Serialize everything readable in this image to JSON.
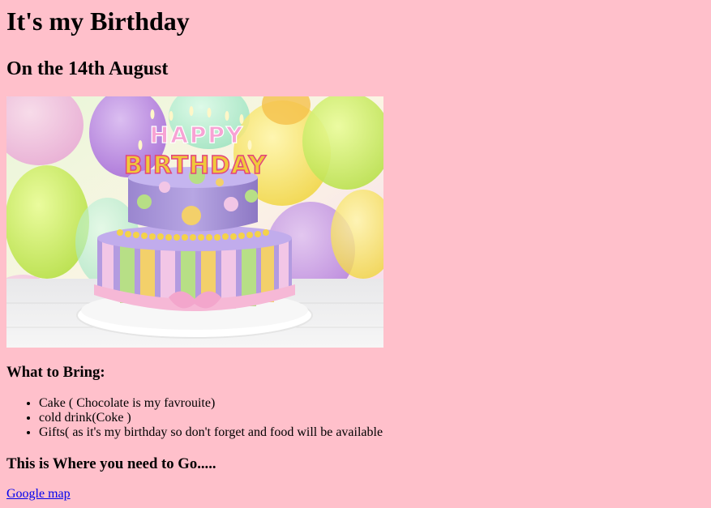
{
  "page": {
    "title": "It's my Birthday",
    "subtitle": "On the 14th August"
  },
  "image": {
    "alt": "Birthday cake",
    "cake_text_top": "HAPPY",
    "cake_text_bottom": "BIRTHDAY"
  },
  "bring": {
    "heading": "What to Bring:",
    "items": [
      "Cake ( Chocolate is my favrouite)",
      "cold drink(Coke )",
      "Gifts( as it's my birthday so don't forget and food will be available"
    ]
  },
  "location": {
    "heading": "This is Where you need to Go.....",
    "link_label": "Google map"
  },
  "colors": {
    "background": "#ffc0cb",
    "link": "#0000ee"
  }
}
